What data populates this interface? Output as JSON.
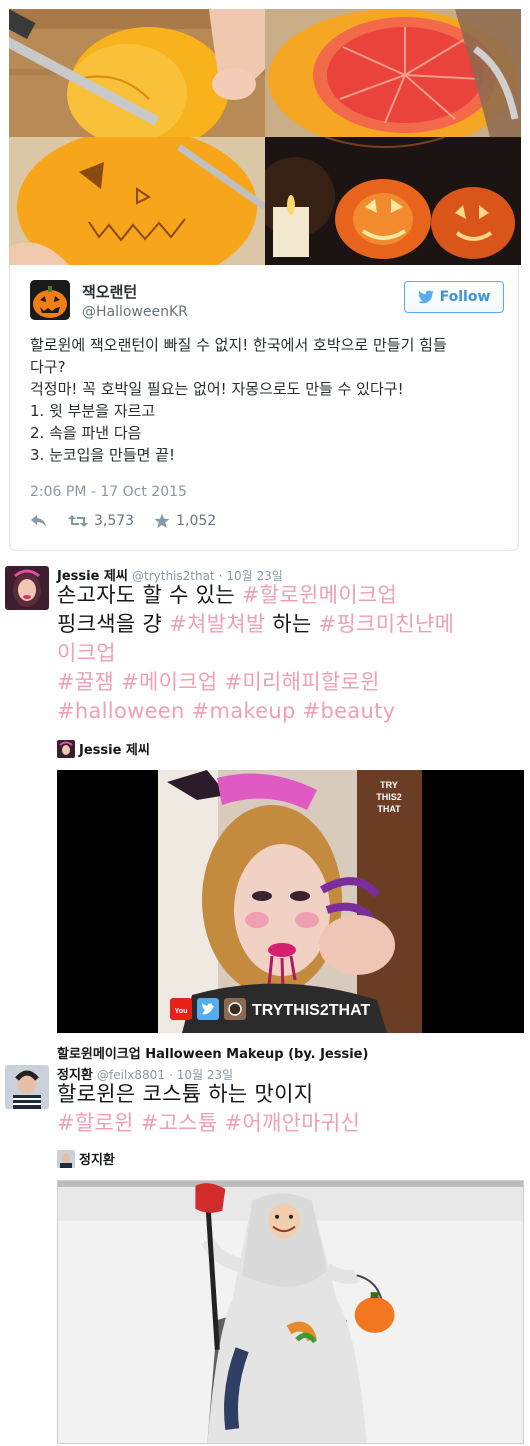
{
  "embedded_tweet": {
    "display_name": "잭오랜턴",
    "handle": "@HalloweenKR",
    "follow_label": "Follow",
    "text_lines": [
      "할로윈에 잭오랜턴이 빠질 수 없지! 한국에서 호박으로 만들기 힘들",
      "다구?",
      "걱정마! 꼭 호박일 필요는 없어! 자몽으로도 만들 수 있다구!",
      "1. 윗 부분을 자르고",
      "2. 속을 파낸 다음",
      "3. 눈코입을 만들면 끝!"
    ],
    "timestamp": "2:06 PM - 17 Oct 2015",
    "retweets": "3,573",
    "likes": "1,052"
  },
  "posts": [
    {
      "author": "Jessie 제씨",
      "handle": "@trythis2that",
      "date": "· 10월 23일",
      "line1_text": "손고자도 할 수 있는 ",
      "line1_tag": "#할로윈메이크업",
      "line2_text": "핑크색을 걍 ",
      "line2_tag1": "#쳐발쳐발",
      "line2_mid": " 하는 ",
      "line2_tag2": "#핑크미친냔메",
      "line3_tag": "이크업",
      "line4_tags": "#꿀잼 #메이크업 #미리해피할로윈",
      "line5_tags": "#halloween #makeup #beauty",
      "media_author": "Jessie 제씨",
      "media_watermark": "TRY THIS2 THAT",
      "media_brand": "TRYTHIS2THAT",
      "media_caption": "할로윈메이크업 Halloween Makeup (by. Jessie)"
    },
    {
      "author": "정지환",
      "handle": "@feilx8801",
      "date": "· 10월 23일",
      "line1_text": "할로윈은 코스튬 하는 맛이지",
      "line2_tags": "#할로윈 #고스튬 #어깨안마귀신",
      "media_author": "정지환"
    }
  ],
  "colors": {
    "hashtag": "#f19fb2",
    "twitter_blue": "#55acee",
    "meta_gray": "#8899a6"
  },
  "icons": [
    "twitter-bird-icon",
    "reply-icon",
    "retweet-icon",
    "like-star-icon",
    "youtube-icon",
    "instagram-icon"
  ]
}
